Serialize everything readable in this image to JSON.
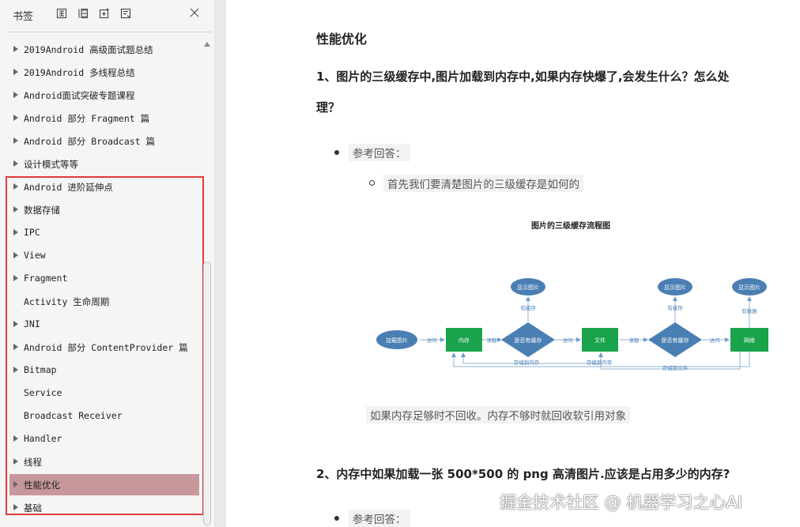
{
  "sidebar": {
    "title": "书签",
    "toolbar_icons": [
      "expand-all-icon",
      "collapse-all-icon",
      "add-bookmark-icon",
      "bookmark-settings-icon"
    ],
    "items": [
      {
        "label": "2019Android 高级面试题总结",
        "has_arrow": true,
        "selected": false
      },
      {
        "label": "2019Android 多线程总结",
        "has_arrow": true,
        "selected": false
      },
      {
        "label": "Android面试突破专题课程",
        "has_arrow": true,
        "selected": false
      },
      {
        "label": "Android 部分 Fragment 篇",
        "has_arrow": true,
        "selected": false
      },
      {
        "label": "Android 部分 Broadcast 篇",
        "has_arrow": true,
        "selected": false
      },
      {
        "label": "设计模式等等",
        "has_arrow": true,
        "selected": false
      },
      {
        "label": "Android 进阶延伸点",
        "has_arrow": true,
        "selected": false
      },
      {
        "label": "数据存储",
        "has_arrow": true,
        "selected": false
      },
      {
        "label": "IPC",
        "has_arrow": true,
        "selected": false
      },
      {
        "label": "View",
        "has_arrow": true,
        "selected": false
      },
      {
        "label": "Fragment",
        "has_arrow": true,
        "selected": false
      },
      {
        "label": " Activity 生命周期",
        "has_arrow": false,
        "selected": false
      },
      {
        "label": "JNI",
        "has_arrow": true,
        "selected": false
      },
      {
        "label": "Android 部分 ContentProvider 篇",
        "has_arrow": true,
        "selected": false
      },
      {
        "label": "Bitmap",
        "has_arrow": true,
        "selected": false
      },
      {
        "label": "Service",
        "has_arrow": false,
        "selected": false
      },
      {
        "label": "Broadcast Receiver",
        "has_arrow": false,
        "selected": false
      },
      {
        "label": "Handler",
        "has_arrow": true,
        "selected": false
      },
      {
        "label": "线程",
        "has_arrow": true,
        "selected": false
      },
      {
        "label": "性能优化",
        "has_arrow": true,
        "selected": true
      },
      {
        "label": "基础",
        "has_arrow": true,
        "selected": false
      }
    ]
  },
  "document": {
    "section_title": "性能优化",
    "q1_line1": "1、图片的三级缓存中,图片加载到内存中,如果内存快爆了,会发生什么？怎么处",
    "q1_line2": "理？",
    "answer_label_1": "参考回答：",
    "sub_answer_1": "首先我们要清楚图片的三级缓存是如何的",
    "diagram": {
      "title": "图片的三级缓存流程图",
      "nodes": {
        "load_image": "加载图片",
        "memory": "内存",
        "has_cache_1": "是否有缓存",
        "file": "文件",
        "has_cache_2": "是否有缓存",
        "network": "网络",
        "show_image_1": "显示图片",
        "show_image_2": "显示图片",
        "show_image_3": "显示图片"
      },
      "edge_labels": {
        "visit_1": "访问",
        "read_1": "读取",
        "visit_2": "访问",
        "read_2": "读取",
        "visit_3": "访问",
        "has_cache_a": "有缓存",
        "has_cache_b": "有缓存",
        "has_data": "有数据",
        "store_memory_1": "存储到内存",
        "store_memory_2": "存储到内存",
        "store_file": "存储到文件"
      },
      "colors": {
        "green": "#1aa34a",
        "blue": "#4a7fb3",
        "line": "#8fb3d6"
      }
    },
    "after_diagram": "如果内存足够时不回收。内存不够时就回收软引用对象",
    "q2": "2、内存中如果加载一张 500*500 的 png 高清图片.应该是占用多少的内存?",
    "answer_label_2": "参考回答："
  },
  "watermark": "掘金技术社区 @ 机器学习之心AI"
}
